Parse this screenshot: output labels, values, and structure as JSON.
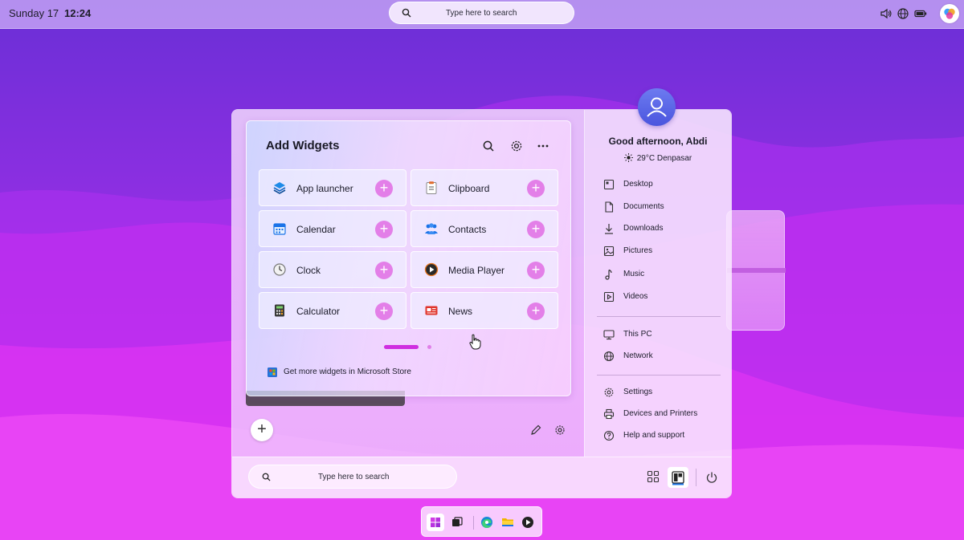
{
  "topbar": {
    "date": "Sunday 17",
    "time": "12:24",
    "search_placeholder": "Type here to search",
    "tray_icons": [
      "volume-icon",
      "globe-icon",
      "battery-icon",
      "copilot-icon"
    ]
  },
  "widgets_panel": {
    "title": "Add Widgets",
    "header_icons": [
      "search-icon",
      "gear-icon",
      "more-icon"
    ],
    "items": [
      {
        "label": "App launcher",
        "icon": "layers-icon"
      },
      {
        "label": "Clipboard",
        "icon": "clipboard-icon"
      },
      {
        "label": "Calendar",
        "icon": "calendar-icon"
      },
      {
        "label": "Contacts",
        "icon": "contacts-icon"
      },
      {
        "label": "Clock",
        "icon": "clock-icon"
      },
      {
        "label": "Media Player",
        "icon": "media-player-icon"
      },
      {
        "label": "Calculator",
        "icon": "calculator-icon"
      },
      {
        "label": "News",
        "icon": "news-icon"
      }
    ],
    "store_link": "Get more widgets in Microsoft Store",
    "pages": 2,
    "current_page": 1
  },
  "user_panel": {
    "greeting": "Good afternoon, Abdi",
    "weather": "29°C  Denpasar",
    "folders": [
      {
        "label": "Desktop",
        "icon": "desktop-icon"
      },
      {
        "label": "Documents",
        "icon": "document-icon"
      },
      {
        "label": "Downloads",
        "icon": "download-icon"
      },
      {
        "label": "Pictures",
        "icon": "pictures-icon"
      },
      {
        "label": "Music",
        "icon": "music-icon"
      },
      {
        "label": "Videos",
        "icon": "videos-icon"
      }
    ],
    "places": [
      {
        "label": "This PC",
        "icon": "monitor-icon"
      },
      {
        "label": "Network",
        "icon": "network-icon"
      }
    ],
    "system": [
      {
        "label": "Settings",
        "icon": "gear-icon"
      },
      {
        "label": "Devices and Printers",
        "icon": "printer-icon"
      },
      {
        "label": "Help and support",
        "icon": "help-icon"
      }
    ]
  },
  "start_bottom": {
    "search_placeholder": "Type here to search"
  },
  "taskbar": {
    "apps": [
      "start-icon",
      "task-view-icon",
      "edge-icon",
      "file-explorer-icon",
      "media-player-icon"
    ]
  },
  "colors": {
    "accent": "#cf2ee0",
    "add_button": "#e37fe8"
  }
}
